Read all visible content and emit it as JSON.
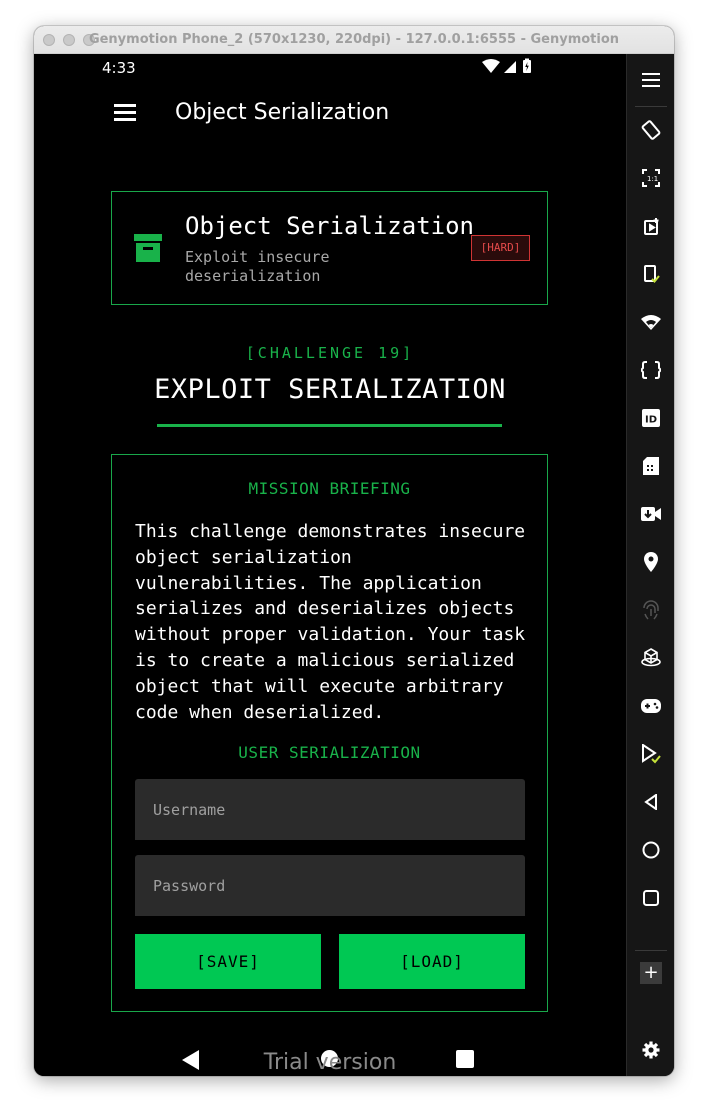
{
  "window": {
    "title": "Genymotion Phone_2 (570x1230, 220dpi) - 127.0.0.1:6555 - Genymotion"
  },
  "status_bar": {
    "time": "4:33"
  },
  "app_bar": {
    "title": "Object Serialization"
  },
  "header_card": {
    "title": "Object Serialization",
    "subtitle": "Exploit insecure deserialization",
    "difficulty": "[HARD]"
  },
  "challenge": {
    "label": "[CHALLENGE 19]",
    "title": "EXPLOIT SERIALIZATION"
  },
  "mission": {
    "briefing_title": "MISSION BRIEFING",
    "briefing_text": "This challenge demonstrates insecure object serialization vulnerabilities. The application serializes and deserializes objects without proper validation. Your task is to create a malicious serialized object that will execute arbitrary code when deserialized.",
    "section_title": "USER SERIALIZATION",
    "username_placeholder": "Username",
    "password_placeholder": "Password",
    "save_label": "[SAVE]",
    "load_label": "[LOAD]"
  },
  "watermark": "Trial version",
  "colors": {
    "accent_green": "#19b24a",
    "button_green": "#00c853",
    "hard_red": "#e34a4a",
    "background": "#000000",
    "field_bg": "#2b2b2b"
  },
  "sidebar_icons": [
    "menu-icon",
    "rotate-icon",
    "pixel-perfect-icon",
    "screen-capture-icon",
    "clipboard-icon",
    "wifi-icon",
    "capture-icon",
    "device-id-icon",
    "sim-icon",
    "camera-icon",
    "gps-icon",
    "fingerprint-icon",
    "motion-sensor-icon",
    "gamepad-icon",
    "open-gapps-icon",
    "back-icon",
    "home-icon",
    "recent-apps-icon",
    "plus-icon",
    "settings-icon"
  ]
}
